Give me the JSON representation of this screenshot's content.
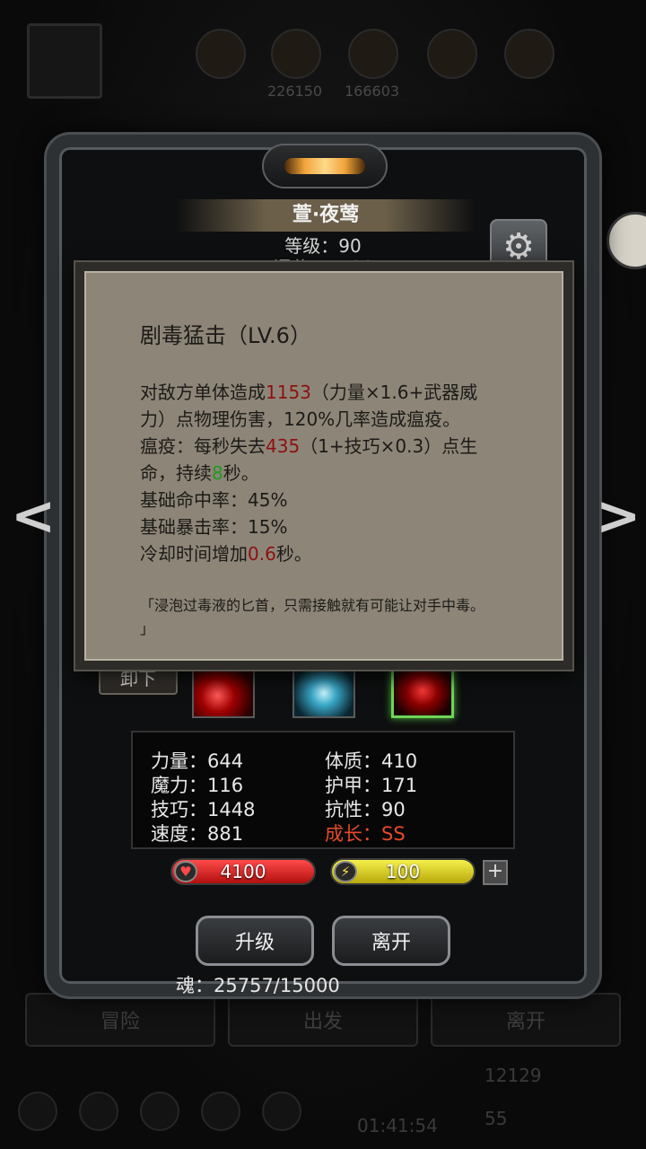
{
  "hero": {
    "name": "萱·夜莺",
    "level_line": "等级：90",
    "score_line": "评分：5706"
  },
  "tooltip": {
    "title": "剧毒猛击（LV.6）",
    "line1_a": "对敌方单体造成",
    "line1_dmg": "1153",
    "line1_b": "（力量×1.6+武器威",
    "line2": "力）点物理伤害，120%几率造成瘟疫。",
    "line3_a": "瘟疫：每秒失去",
    "line3_val": "435",
    "line3_b": "（1+技巧×0.3）点生",
    "line4_a": "命，持续",
    "line4_val": "8",
    "line4_b": "秒。",
    "hit_rate": "基础命中率：45%",
    "crit_rate": "基础暴击率：15%",
    "cooldown_a": "冷却时间增加",
    "cooldown_val": "0.6",
    "cooldown_b": "秒。",
    "quote_line1": "「浸泡过毒液的匕首，只需接触就有可能让对手中毒。",
    "quote_line2": "」"
  },
  "unequip_label": "卸下",
  "stats": {
    "strength": "力量：644",
    "constitution": "体质：410",
    "magic": "魔力：116",
    "armor": "护甲：171",
    "skill": "技巧：1448",
    "resistance": "抗性：90",
    "speed": "速度：881",
    "growth": "成长：SS"
  },
  "hp_value": "4100",
  "energy_value": "100",
  "plus_label": "+",
  "buttons": {
    "upgrade": "升级",
    "leave": "离开"
  },
  "soul_line": "魂：25757/15000",
  "background": {
    "top_numbers": [
      "226150",
      "166603"
    ],
    "nav": [
      "冒险",
      "出发",
      "离开"
    ],
    "resource_gold": "12129",
    "resource_gem": "55",
    "timer": "01:41:54"
  },
  "colors": {
    "damage_red": "#8f1010",
    "duration_green": "#1f9a1f",
    "growth_red": "#e64a2a",
    "hp_red": "#d41c1c",
    "energy_yellow": "#e0d428"
  },
  "icons": {
    "gear": "gear-icon",
    "heart": "heart-icon",
    "lightning": "lightning-icon",
    "left_arrow": "chevron-left-icon",
    "right_arrow": "chevron-right-icon"
  }
}
